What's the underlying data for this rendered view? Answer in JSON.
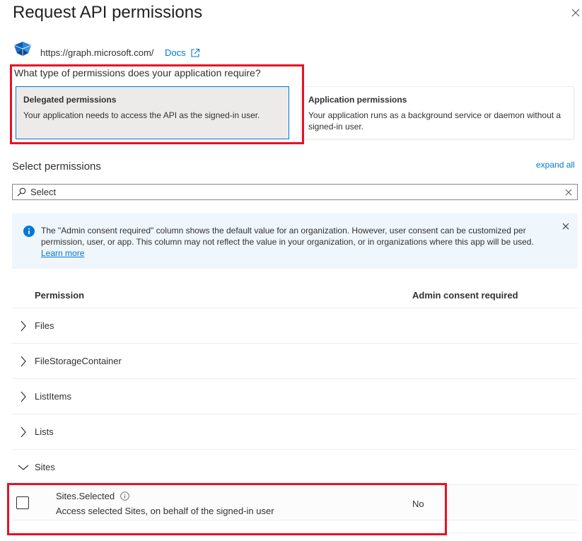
{
  "panel": {
    "title": "Request API permissions"
  },
  "api": {
    "url": "https://graph.microsoft.com/",
    "docs_label": "Docs"
  },
  "permission_type": {
    "question": "What type of permissions does your application require?",
    "delegated": {
      "title": "Delegated permissions",
      "description": "Your application needs to access the API as the signed-in user."
    },
    "application": {
      "title": "Application permissions",
      "description": "Your application runs as a background service or daemon without a signed-in user."
    }
  },
  "select": {
    "label": "Select permissions",
    "expand_all": "expand all",
    "search_placeholder": "Select"
  },
  "info": {
    "message": "The \"Admin consent required\" column shows the default value for an organization. However, user consent can be customized per permission, user, or app. This column may not reflect the value in your organization, or in organizations where this app will be used.",
    "link": "Learn more"
  },
  "table": {
    "col_permission": "Permission",
    "col_admin": "Admin consent required",
    "groups": [
      {
        "label": "Files",
        "expanded": false
      },
      {
        "label": "FileStorageContainer",
        "expanded": false
      },
      {
        "label": "ListItems",
        "expanded": false
      },
      {
        "label": "Lists",
        "expanded": false
      },
      {
        "label": "Sites",
        "expanded": true
      }
    ],
    "sites_permission": {
      "name": "Sites.Selected",
      "description": "Access selected Sites, on behalf of the signed-in user",
      "admin_consent": "No",
      "checked": false
    }
  },
  "colors": {
    "accent": "#0078d4",
    "highlight_box": "#e81123",
    "info_background": "#eff6fc"
  }
}
